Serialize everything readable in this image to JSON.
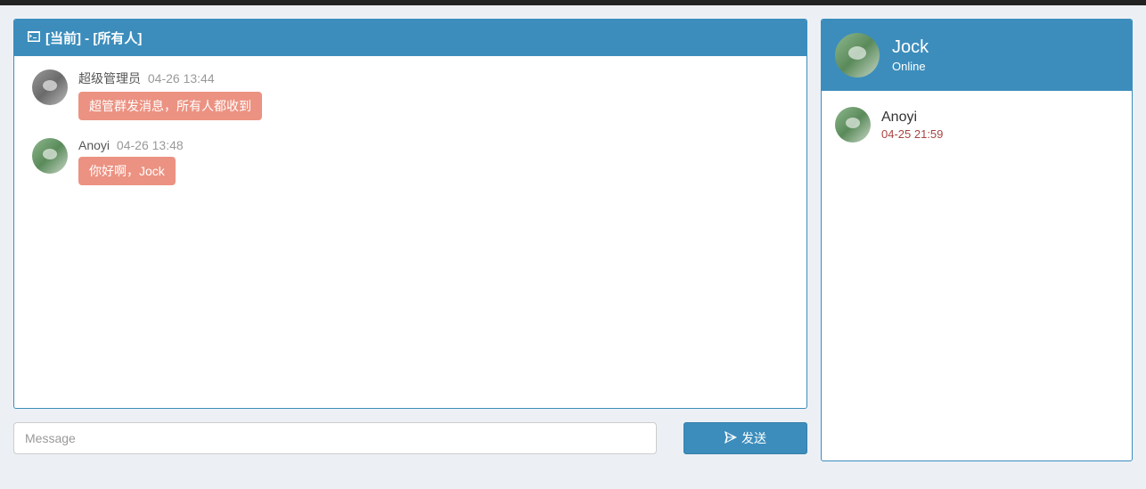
{
  "chat": {
    "header": {
      "label_current": "[当前]",
      "label_sep": "-",
      "label_target": "[所有人]"
    },
    "messages": [
      {
        "sender": "超级管理员",
        "time": "04-26 13:44",
        "text": "超管群发消息，所有人都收到"
      },
      {
        "sender": "Anoyi",
        "time": "04-26 13:48",
        "text": "你好啊，Jock"
      }
    ]
  },
  "input": {
    "placeholder": "Message",
    "send_label": "发送"
  },
  "sidebar": {
    "user": {
      "name": "Jock",
      "status": "Online"
    },
    "contacts": [
      {
        "name": "Anoyi",
        "time": "04-25 21:59"
      }
    ]
  }
}
